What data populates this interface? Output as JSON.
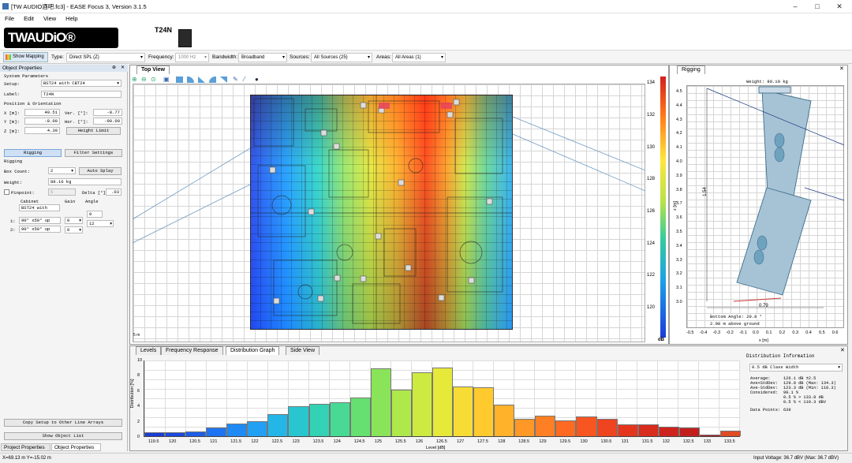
{
  "window": {
    "title": "[TW AUDIO酒吧.fc3] - EASE Focus 3, Version 3.1.5",
    "minimize": "–",
    "maximize": "□",
    "close": "✕"
  },
  "menu": [
    "File",
    "Edit",
    "View",
    "Help"
  ],
  "brand": {
    "logo": "TWAUDiO®",
    "speaker": "T24N"
  },
  "toolbar": {
    "show_mapping": "Show Mapping",
    "type_label": "Type:",
    "type_value": "Direct SPL (Z)",
    "freq_label": "Frequency:",
    "freq_value": "1000 Hz",
    "bw_label": "Bandwidth:",
    "bw_value": "Broadband",
    "src_label": "Sources:",
    "src_value": "All Sources (25)",
    "areas_label": "Areas:",
    "areas_value": "All Areas (1)"
  },
  "object_props": {
    "header": "Object Properties",
    "pin": "📌",
    "close": "✕",
    "sys_params": "System Parameters",
    "setup_label": "Setup:",
    "setup_value": "BST24 with CBT24",
    "label_label": "Label:",
    "label_value": "T24N",
    "pos_header": "Position & Orientation",
    "x_label": "X [m]:",
    "x_value": "49.51",
    "ver_label": "Ver. [°]:",
    "ver_value": "-8.77",
    "y_label": "Y [m]:",
    "y_value": "-8.00",
    "hor_label": "Hor. [°]:",
    "hor_value": "-90.00",
    "z_label": "Z [m]:",
    "z_value": "4.30",
    "height_limit": "Height Limit",
    "rigging_btn": "Rigging",
    "filter_btn": "Filter Settings",
    "rigging_header": "Rigging",
    "box_count_label": "Box Count:",
    "box_count_value": "2",
    "auto_splay": "Auto Splay",
    "weight_label": "Weight:",
    "weight_value": "89.10 kg",
    "pinpoint_label": "Pinpoint:",
    "pinpoint_value": "5",
    "delta_label": "Delta [°]",
    "delta_value": ".03",
    "col_cabinet": "Cabinet",
    "col_gain": "Gain",
    "col_angle": "Angle",
    "cab_header_value": "BST24 with",
    "rows": [
      {
        "n": "1:",
        "cab": "90° x50° up",
        "gain": "0",
        "angle_top": "0",
        "angle": ""
      },
      {
        "n": "2:",
        "cab": "90° x50° up",
        "gain": "0",
        "angle": "12"
      }
    ],
    "copy_setup": "Copy Setup to Other Line Arrays",
    "show_list": "Show Object List"
  },
  "bottom_tabs": [
    "Project Properties",
    "Object Properties"
  ],
  "status": {
    "coords": "X=69.13 m Y=-15.02 m",
    "voltage": "Input Voltage: 36.7 dBV (Max: 36.7 dBV)"
  },
  "top_view": {
    "tab": "Top View",
    "scale": "5 m",
    "colorbar_unit": "dB",
    "colorbar_ticks": [
      "134",
      "132",
      "130",
      "128",
      "126",
      "124",
      "122",
      "120"
    ]
  },
  "rigging_panel": {
    "tab": "Rigging",
    "close": "✕",
    "weight": "Weight: 89.10 kg",
    "dim_h": "1.54",
    "dim_w": "0.79",
    "bottom_angle": "Bottom Angle: 20.8 °",
    "above_ground": "2.98 m above ground",
    "y_ticks": [
      "4.5",
      "4.4",
      "4.3",
      "4.2",
      "4.1",
      "4.0",
      "3.9",
      "3.8",
      "3.7",
      "3.6",
      "3.5",
      "3.4",
      "3.3",
      "3.2",
      "3.1",
      "3.0"
    ],
    "x_ticks": [
      "-0.5",
      "-0.4",
      "-0.3",
      "-0.2",
      "-0.1",
      "0.0",
      "0.1",
      "0.2",
      "0.3",
      "0.4",
      "0.5",
      "0.6"
    ],
    "x_axis": "x [m]",
    "y_axis": "z [m]"
  },
  "dist_tabs": [
    "Levels",
    "Frequency Response",
    "Distribution Graph",
    "Side View"
  ],
  "dist_info": {
    "header": "Distribution Information",
    "class_width": "0.5 dB Class Width",
    "rows": [
      [
        "Average:",
        "126.1 dB ±2.5"
      ],
      [
        "Ave+StdDev:",
        "129.0 dB (Max: 134.3)"
      ],
      [
        "Ave-StdDev:",
        "123.3 dB (Min: 118.3)"
      ],
      [
        "Considered:",
        "99.1 %"
      ],
      [
        "",
        "0.5 % > 133.8 dB"
      ],
      [
        "",
        "0.5 % < 119.3 dBV"
      ],
      [
        "Data Points:",
        "639"
      ]
    ]
  },
  "chart_data": {
    "type": "bar",
    "xlabel": "Level [dB]",
    "ylabel": "Distribution [%]",
    "ylim": [
      0,
      10
    ],
    "yticks": [
      "10",
      "8",
      "6",
      "4",
      "2",
      "0"
    ],
    "categories": [
      "119.5",
      "120",
      "120.5",
      "121",
      "121.5",
      "122",
      "122.5",
      "123",
      "123.5",
      "124",
      "124.5",
      "125",
      "125.5",
      "126",
      "126.5",
      "127",
      "127.5",
      "128",
      "128.5",
      "129",
      "129.5",
      "130",
      "130.5",
      "131",
      "131.5",
      "132",
      "132.5",
      "133",
      "133.5"
    ],
    "values": [
      0.5,
      0.5,
      0.6,
      1.1,
      1.7,
      2.0,
      2.9,
      3.9,
      4.2,
      4.4,
      5.1,
      8.9,
      6.1,
      8.4,
      9.0,
      6.5,
      6.4,
      4.1,
      2.3,
      2.7,
      2.1,
      2.6,
      2.3,
      1.5,
      1.5,
      1.2,
      1.1,
      0.2,
      0.7
    ],
    "colors": [
      "#1a3cd8",
      "#1a48e0",
      "#1c5ee8",
      "#1e74f0",
      "#1f8af4",
      "#21a0f4",
      "#25b6e8",
      "#2ac6d0",
      "#33d2b4",
      "#48da94",
      "#66e070",
      "#8ae45a",
      "#aee84a",
      "#cdea40",
      "#e6e83a",
      "#f6dc34",
      "#ffca2e",
      "#ffb22a",
      "#ff9826",
      "#ff8024",
      "#ff6a22",
      "#f85620",
      "#ee4420",
      "#e4361e",
      "#d82c1e",
      "#ce241e",
      "#c21e1e",
      "#b81a1a",
      "#e04a24"
    ]
  }
}
